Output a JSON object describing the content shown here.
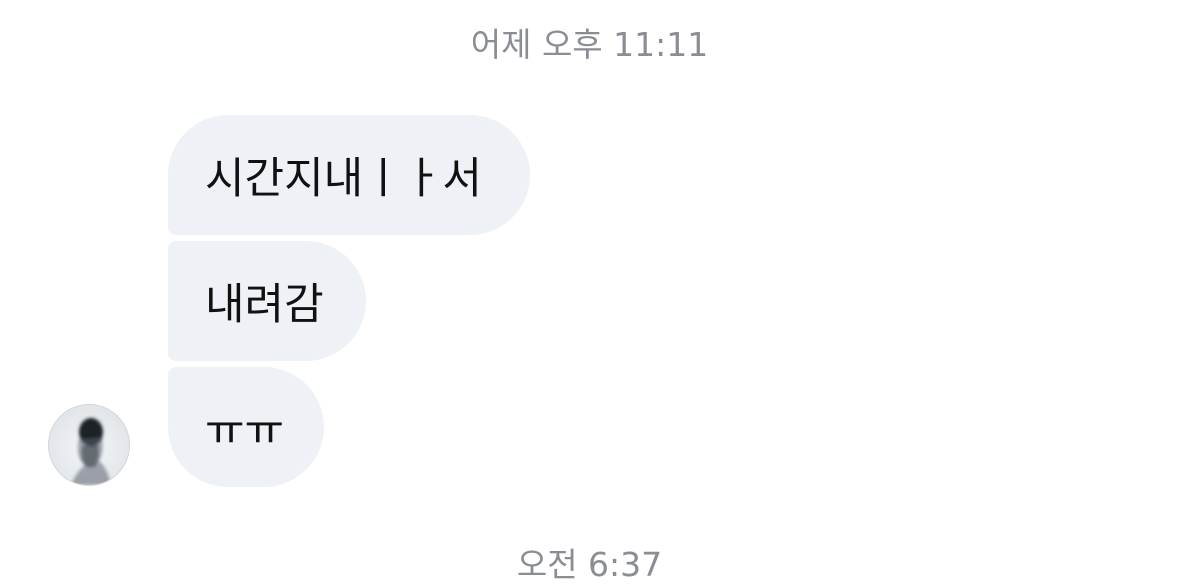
{
  "timestamps": {
    "top": "어제 오후 11:11",
    "bottom": "오전 6:37"
  },
  "messages": [
    {
      "text": "시간지내ㅣㅏ서"
    },
    {
      "text": "내려감"
    },
    {
      "text": "ㅠㅠ"
    }
  ],
  "colors": {
    "bubble_background": "#eef1f5",
    "timestamp_text": "#8a8d93",
    "message_text": "#111111"
  },
  "sender": {
    "avatar_icon": "profile-photo-icon"
  }
}
